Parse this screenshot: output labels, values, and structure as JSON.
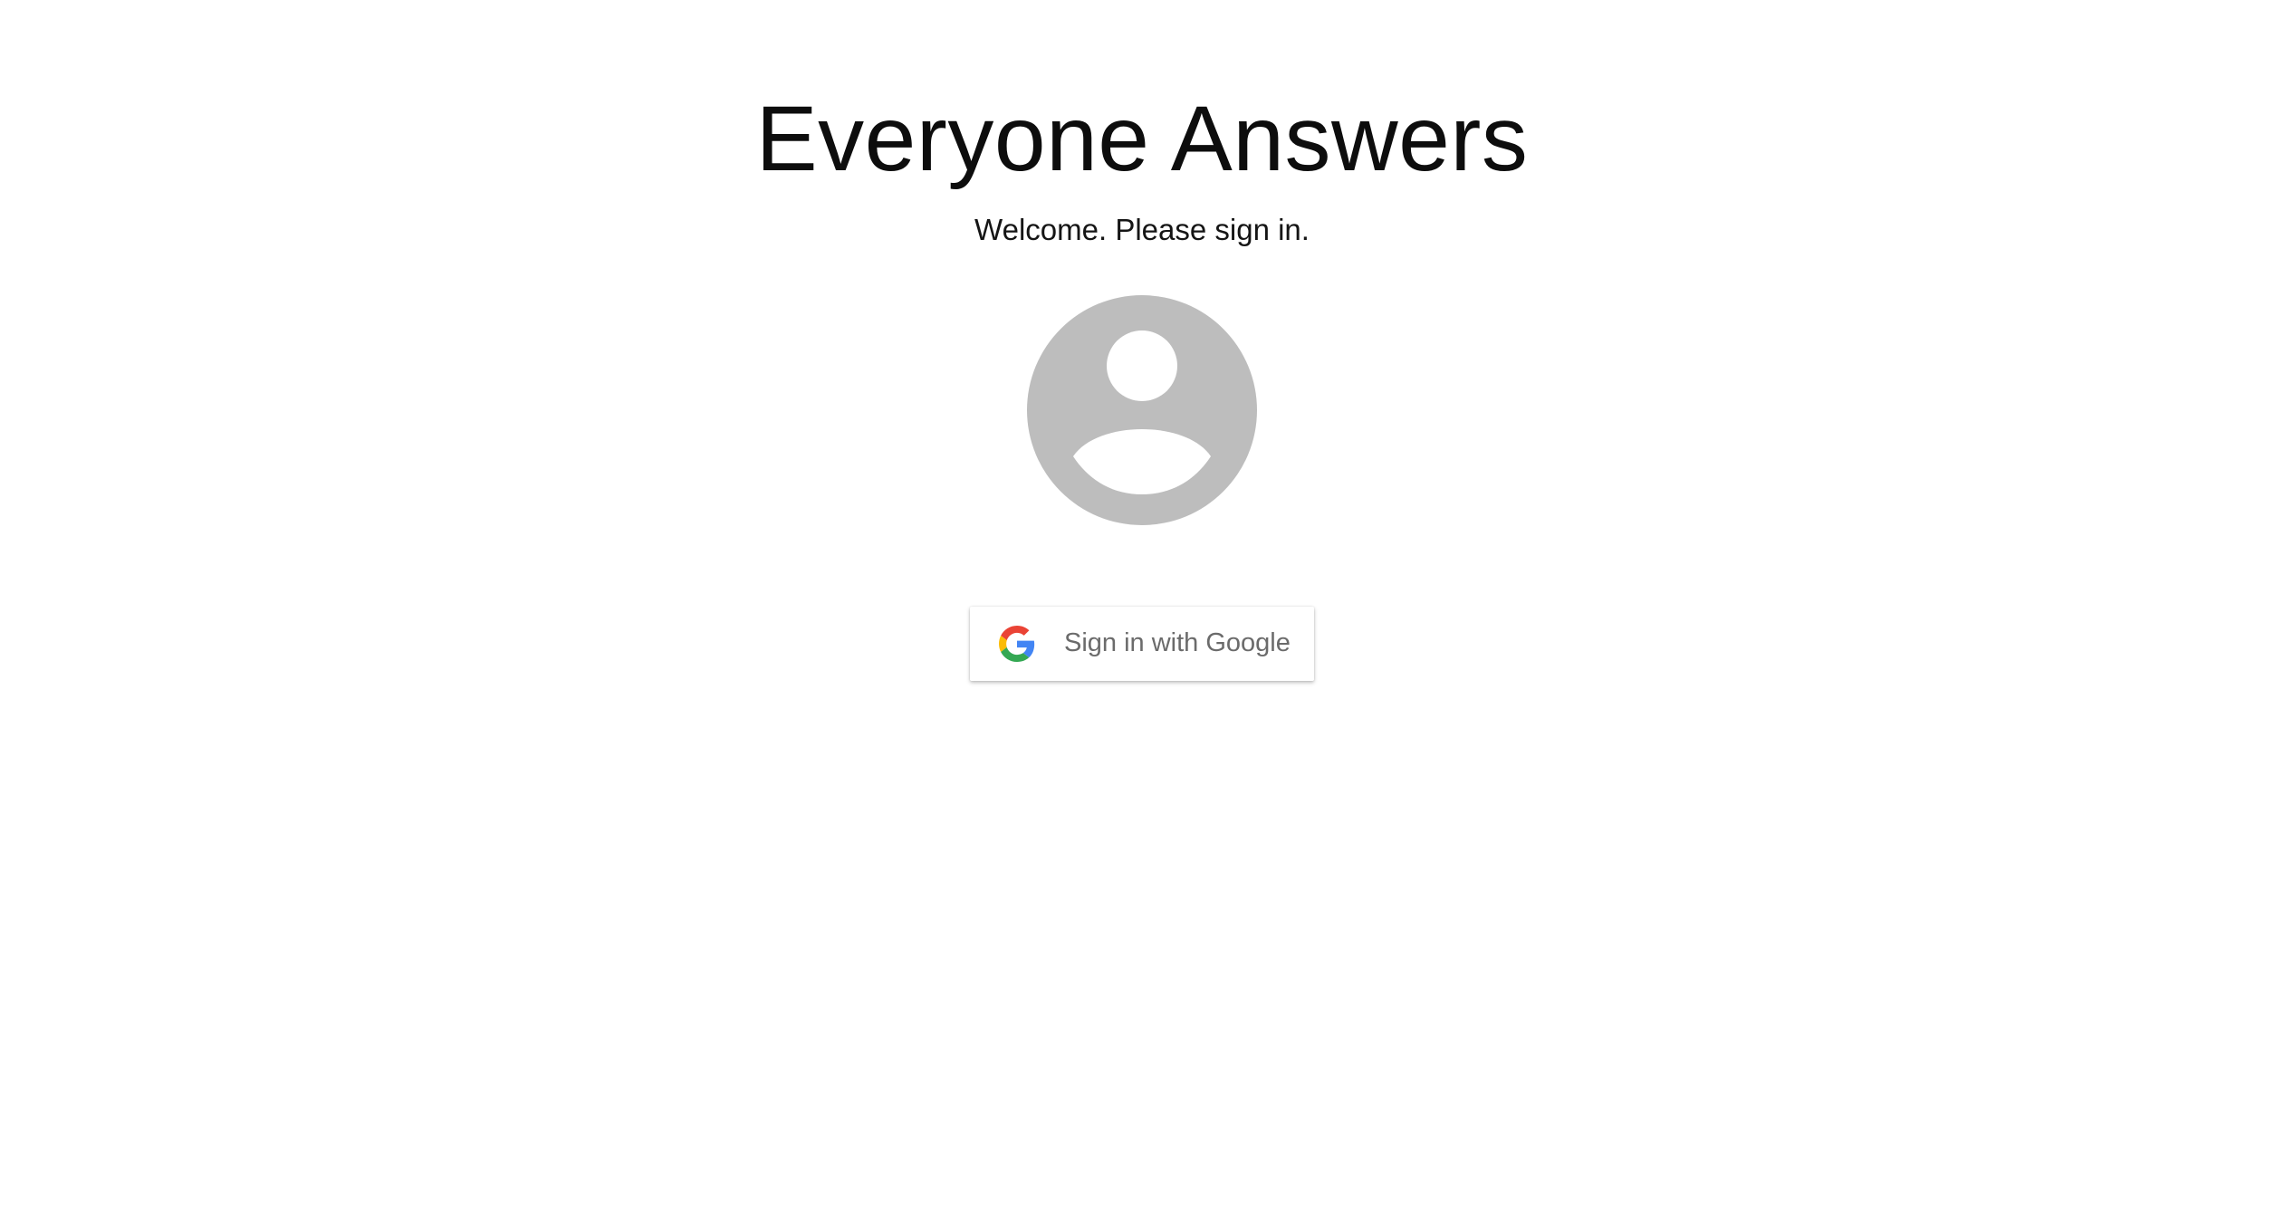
{
  "header": {
    "title": "Everyone Answers",
    "subtitle": "Welcome. Please sign in."
  },
  "avatar": {
    "icon": "user-avatar-icon",
    "color": "#bdbdbd"
  },
  "signin": {
    "label": "Sign in with Google",
    "icon": "google-icon"
  },
  "colors": {
    "background": "#ffffff",
    "text": "#0d0d0d",
    "button_text": "#6b6b6b",
    "avatar": "#bdbdbd"
  }
}
